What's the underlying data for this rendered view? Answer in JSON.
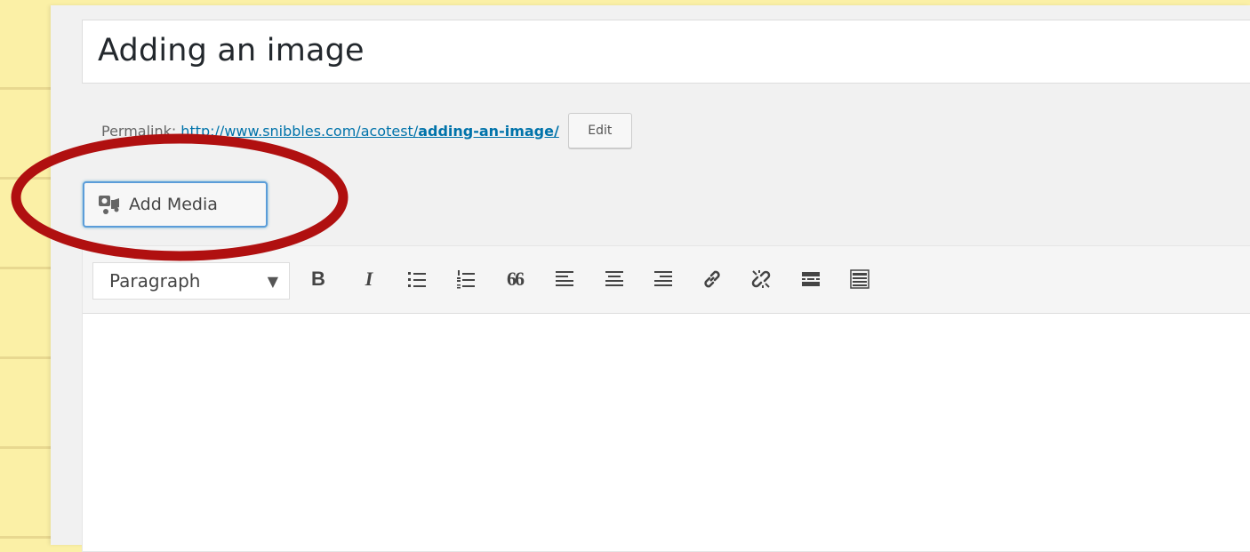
{
  "post": {
    "title": "Adding an image"
  },
  "permalink": {
    "label": "Permalink:",
    "url_base": "http://www.snibbles.com/acotest/",
    "slug": "adding-an-image/",
    "edit_label": "Edit"
  },
  "media": {
    "add_media_label": "Add Media",
    "icon": "add-media-icon"
  },
  "toolbar": {
    "format_selected": "Paragraph",
    "buttons": [
      {
        "name": "bold",
        "icon": "bold-icon",
        "glyph": "B"
      },
      {
        "name": "italic",
        "icon": "italic-icon",
        "glyph": "I"
      },
      {
        "name": "bulleted-list",
        "icon": "bulleted-list-icon"
      },
      {
        "name": "numbered-list",
        "icon": "numbered-list-icon"
      },
      {
        "name": "blockquote",
        "icon": "blockquote-icon",
        "glyph": "66"
      },
      {
        "name": "align-left",
        "icon": "align-left-icon"
      },
      {
        "name": "align-center",
        "icon": "align-center-icon"
      },
      {
        "name": "align-right",
        "icon": "align-right-icon"
      },
      {
        "name": "insert-link",
        "icon": "link-icon"
      },
      {
        "name": "remove-link",
        "icon": "unlink-icon"
      },
      {
        "name": "read-more",
        "icon": "read-more-icon"
      },
      {
        "name": "toolbar-toggle",
        "icon": "keyboard-icon"
      }
    ]
  },
  "annotation": {
    "highlight_color": "#b01010"
  },
  "colors": {
    "link": "#0073aa",
    "focus_border": "#5b9dd9",
    "background": "#fbf0a6"
  }
}
